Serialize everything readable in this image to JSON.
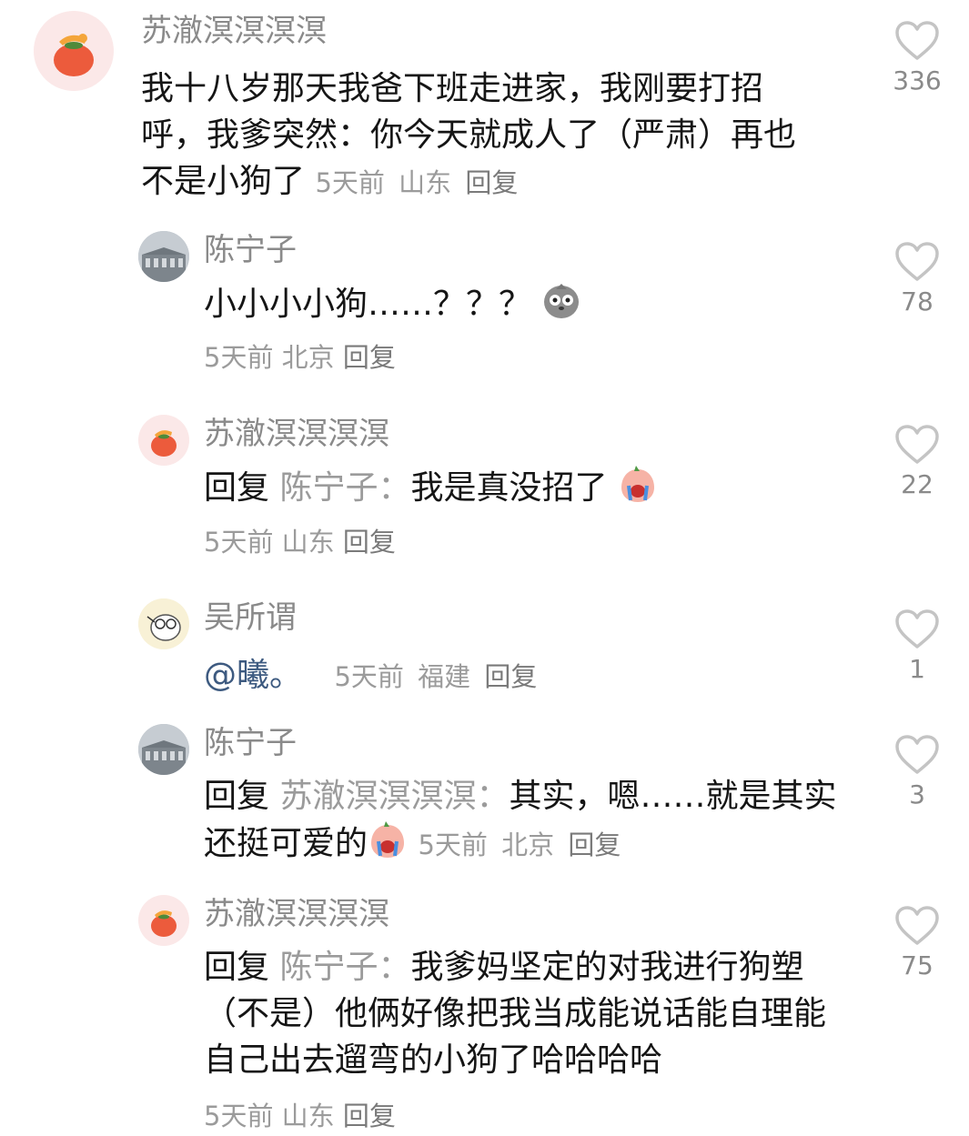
{
  "comments": [
    {
      "user": "苏澈溟溟溟溟",
      "text": "我十八岁那天我爸下班走进家，我刚要打招呼，我爹突然：你今天就成人了（严肃）再也不是小狗了",
      "time": "5天前",
      "location": "山东",
      "reply": "回复",
      "likes": "336"
    },
    {
      "user": "陈宁子",
      "text": "小小小小狗……？？？",
      "emoji": "pigeon-emoji",
      "time": "5天前",
      "location": "北京",
      "reply": "回复",
      "likes": "78"
    },
    {
      "user": "苏澈溟溟溟溟",
      "prefix": "回复",
      "target": "陈宁子：",
      "text": "我是真没招了",
      "emoji": "crying-peach-emoji",
      "time": "5天前",
      "location": "山东",
      "reply": "回复",
      "likes": "22"
    },
    {
      "user": "吴所谓",
      "mention": "@曦。",
      "time": "5天前",
      "location": "福建",
      "reply": "回复",
      "likes": "1"
    },
    {
      "user": "陈宁子",
      "prefix": "回复",
      "target": "苏澈溟溟溟溟：",
      "text": "其实，嗯……就是其实还挺可爱的",
      "emoji": "crying-peach-emoji",
      "time": "5天前",
      "location": "北京",
      "reply": "回复",
      "likes": "3"
    },
    {
      "user": "苏澈溟溟溟溟",
      "prefix": "回复",
      "target": "陈宁子：",
      "text": "我爹妈坚定的对我进行狗塑（不是）他俩好像把我当成能说话能自理能自己出去遛弯的小狗了哈哈哈哈",
      "time": "5天前",
      "location": "山东",
      "reply": "回复",
      "likes": "75"
    }
  ],
  "colors": {
    "text": "#151515",
    "meta": "#9b9b9b",
    "mention": "#3d5a80",
    "heart": "#c4c4c4"
  }
}
